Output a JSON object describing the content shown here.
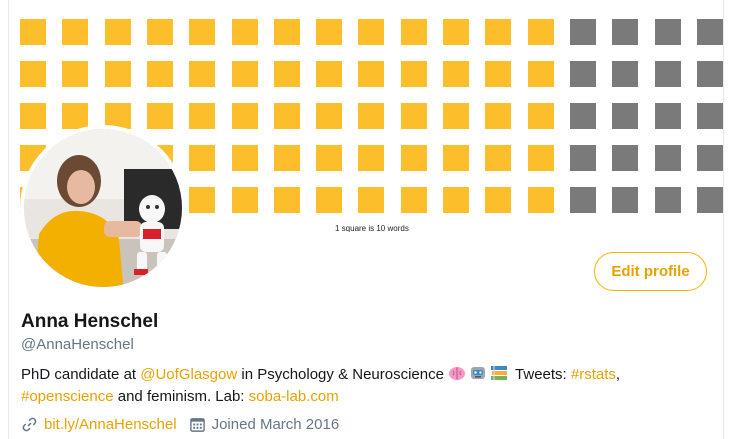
{
  "banner": {
    "caption": "1 square is 10 words",
    "grid": {
      "rows": 5,
      "cols": 17,
      "orange_cols": 13,
      "orange_color": "#fdbe2c",
      "grey_color": "#7a7a7a"
    }
  },
  "profile": {
    "name": "Anna Henschel",
    "handle": "@AnnaHenschel",
    "edit_label": "Edit profile",
    "bio": {
      "part1": "PhD candidate at ",
      "mention": "@UofGlasgow",
      "part2": " in Psychology & Neuroscience ",
      "emojis": [
        "brain-emoji",
        "robot-emoji",
        "books-emoji"
      ],
      "part3": " Tweets: ",
      "hashtag1": "#rstats",
      "part4": ",",
      "hashtag2": "#openscience",
      "part5": " and feminism. Lab: ",
      "lab_link": "soba-lab.com"
    },
    "website": "bit.ly/AnnaHenschel",
    "joined": "Joined March 2016"
  },
  "colors": {
    "accent": "#e8a200",
    "muted": "#657786",
    "text": "#14171a"
  }
}
